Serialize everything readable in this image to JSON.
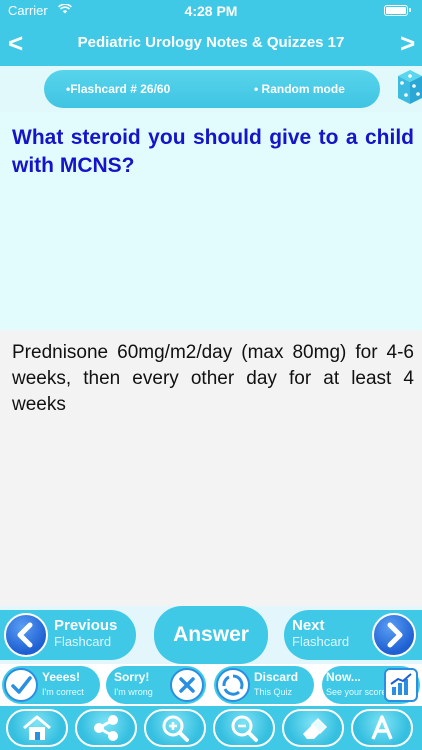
{
  "status_bar": {
    "carrier": "Carrier",
    "time": "4:28 PM"
  },
  "nav": {
    "title": "Pediatric Urology Notes & Quizzes 17",
    "back": "<",
    "forward": ">"
  },
  "info": {
    "flashcard": "•Flashcard #  26/60",
    "mode": "• Random mode"
  },
  "question": "What steroid you should give to a child with MCNS?",
  "answer": "Prednisone 60mg/m2/day (max 80mg) for 4-6 weeks, then every other day for at least 4 weeks",
  "nav_buttons": {
    "previous_line1": "Previous",
    "previous_line2": "Flashcard",
    "answer": "Answer",
    "next_line1": "Next",
    "next_line2": "Flashcard"
  },
  "actions": {
    "correct_line1": "Yeees!",
    "correct_line2": "I'm correct",
    "wrong_line1": "Sorry!",
    "wrong_line2": "I'm wrong",
    "discard_line1": "Discard",
    "discard_line2": "This Quiz",
    "score_line1": "Now...",
    "score_line2": "See your score"
  },
  "toolbar": [
    "home-icon",
    "share-icon",
    "zoom-in-icon",
    "zoom-out-icon",
    "clear-icon",
    "font-icon"
  ],
  "colors": {
    "accent": "#40c9e6",
    "question_text": "#1414c8",
    "question_bg": "#e2fcfe",
    "answer_bg": "#f3f3f3"
  }
}
